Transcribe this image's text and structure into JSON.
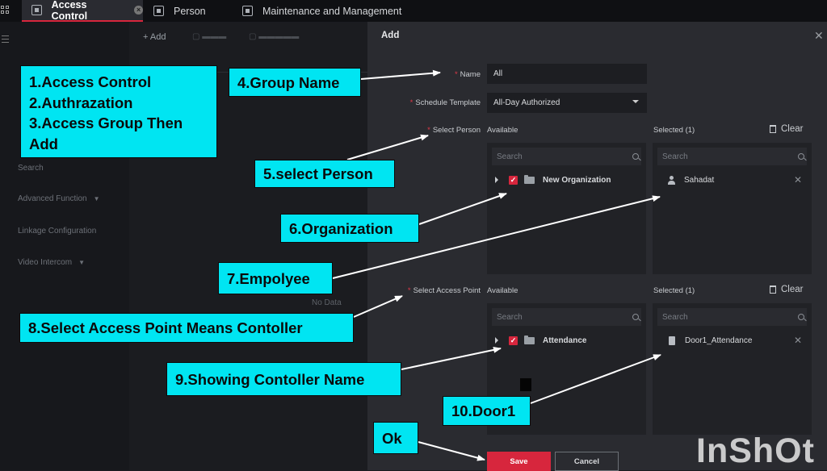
{
  "tabs": [
    {
      "label": "Access Control",
      "active": true
    },
    {
      "label": "Person",
      "active": false
    },
    {
      "label": "Maintenance and Management",
      "active": false
    }
  ],
  "sidebar": {
    "items": [
      "Search",
      "Advanced Function",
      "Linkage Configuration",
      "Video Intercom"
    ]
  },
  "toolbar": {
    "add_label": "Add"
  },
  "table": {
    "empty_text": "No Data"
  },
  "dialog": {
    "title": "Add",
    "name_label": "Name",
    "name_value": "All",
    "schedule_label": "Schedule Template",
    "schedule_value": "All-Day Authorized",
    "select_person_label": "Select Person",
    "select_access_point_label": "Select Access Point",
    "available_label": "Available",
    "selected_label": "Selected  (1)",
    "clear_label": "Clear",
    "search_placeholder": "Search",
    "person_tree_item": "New Organization",
    "selected_person": "Sahadat",
    "access_tree_item": "Attendance",
    "selected_door": "Door1_Attendance",
    "save_label": "Save",
    "cancel_label": "Cancel"
  },
  "callouts": {
    "steps": [
      "1.Access Control",
      "2.Authrazation",
      "3.Access Group Then",
      "Add"
    ],
    "group_name": "4.Group Name",
    "select_person": "5.select Person",
    "organization": "6.Organization",
    "employee": "7.Empolyee",
    "access_point": "8.Select Access Point Means Contoller",
    "controller_name": "9.Showing Contoller Name",
    "door": "10.Door1",
    "ok": "Ok"
  },
  "watermark": "InShOt",
  "colors": {
    "accent_red": "#d7263d",
    "callout_cyan": "#00e5f2",
    "dialog_bg": "#2a2b30"
  }
}
